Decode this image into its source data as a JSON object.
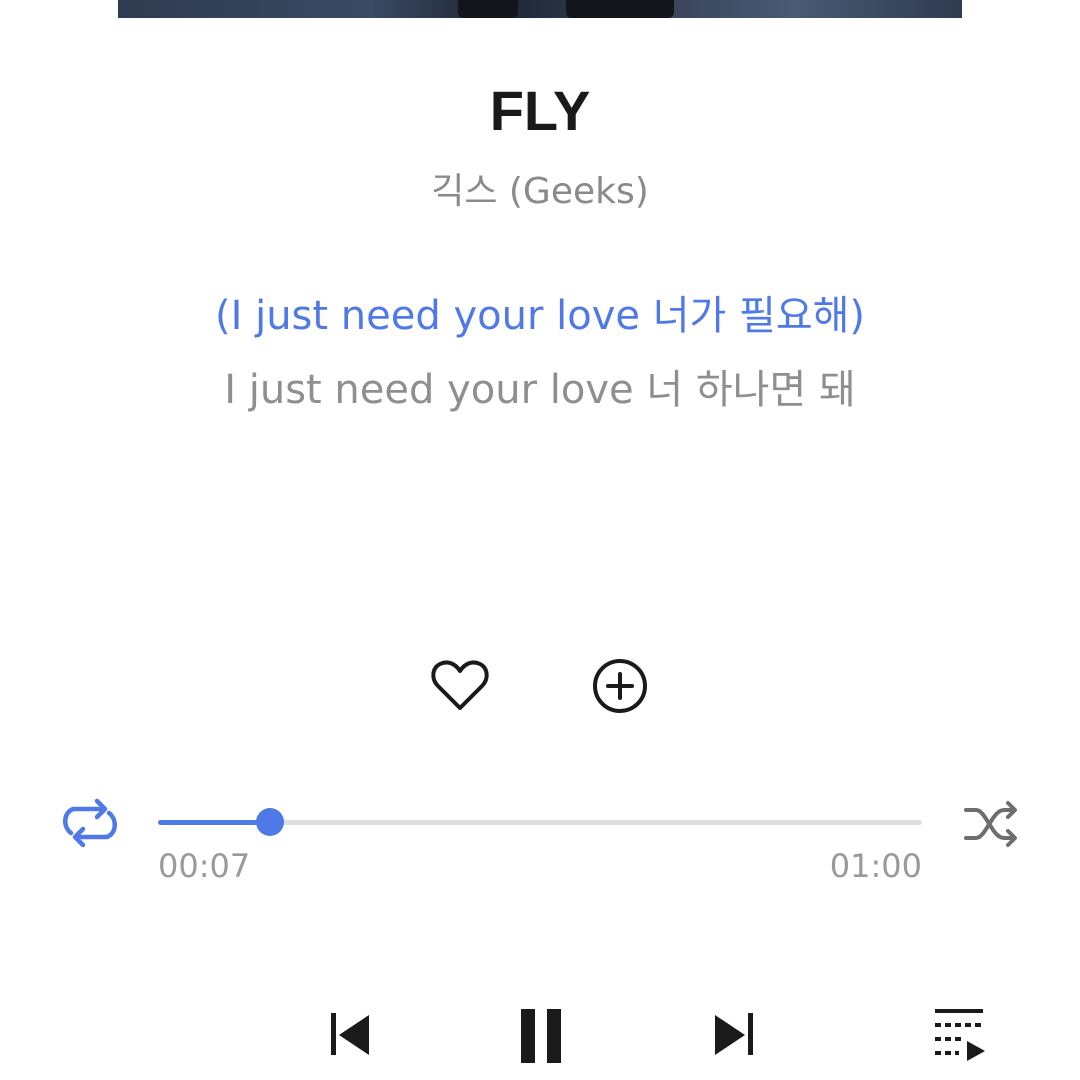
{
  "track": {
    "title": "FLY",
    "artist": "긱스 (Geeks)"
  },
  "lyrics": {
    "current": "(I just need your love 너가 필요해)",
    "next": "I just need your love 너 하나면 돼"
  },
  "actions": {
    "like_icon": "heart-outline-icon",
    "add_icon": "add-circle-icon"
  },
  "playback": {
    "elapsed": "00:07",
    "total": "01:00",
    "progress_fraction": 0.146,
    "repeat_icon": "repeat-icon",
    "shuffle_icon": "shuffle-icon",
    "state": "playing"
  },
  "controls": {
    "previous_icon": "skip-previous-icon",
    "play_pause_icon": "pause-icon",
    "next_icon": "skip-next-icon",
    "queue_icon": "playlist-icon"
  },
  "colors": {
    "accent": "#4f79e6",
    "title": "#1a1a1a",
    "secondary_text": "#8a8a8a",
    "track_background": "#dedede",
    "icon": "#1a1a1a"
  }
}
